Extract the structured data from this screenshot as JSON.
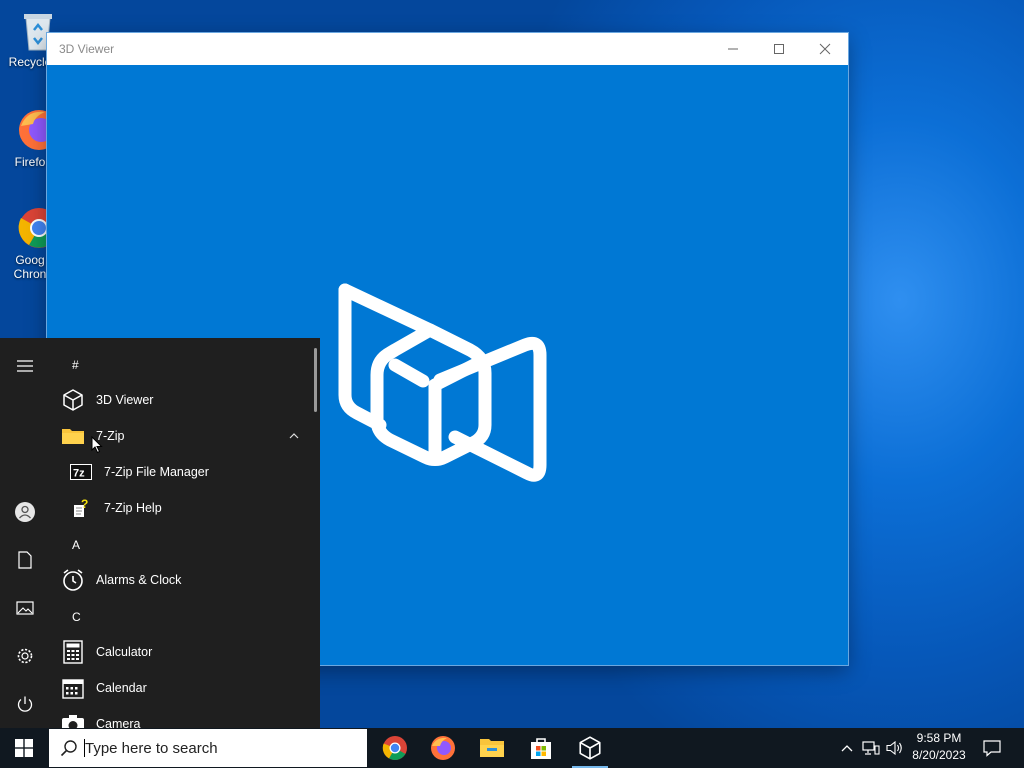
{
  "desktop": {
    "icons": [
      {
        "label": "Recycle",
        "icon": "recycle-bin-icon"
      },
      {
        "label": "Firefo",
        "icon": "firefox-icon"
      },
      {
        "label": "Goog\nChron",
        "icon": "chrome-icon"
      }
    ]
  },
  "window": {
    "title": "3D Viewer",
    "minimize_icon": "minimize-icon",
    "maximize_icon": "maximize-icon",
    "close_icon": "close-icon",
    "background": "#0078d4",
    "splash_icon": "3d-viewer-logo-icon"
  },
  "start_menu": {
    "rail": [
      "hamburger-icon",
      "user-icon",
      "document-icon",
      "pictures-icon",
      "settings-icon",
      "power-icon"
    ],
    "sections": [
      {
        "letter": "#"
      },
      {
        "app": "3D Viewer",
        "icon": "3d-cube-icon"
      },
      {
        "app": "7-Zip",
        "icon": "folder-icon",
        "expanded": true
      },
      {
        "app": "7-Zip File Manager",
        "icon": "7zip-icon",
        "sub": true
      },
      {
        "app": "7-Zip Help",
        "icon": "help-document-icon",
        "sub": true
      },
      {
        "letter": "A"
      },
      {
        "app": "Alarms & Clock",
        "icon": "alarm-clock-icon"
      },
      {
        "letter": "C"
      },
      {
        "app": "Calculator",
        "icon": "calculator-icon"
      },
      {
        "app": "Calendar",
        "icon": "calendar-icon"
      },
      {
        "app": "Camera",
        "icon": "camera-icon"
      }
    ]
  },
  "taskbar": {
    "search_placeholder": "Type here to search",
    "apps": [
      "chrome-icon",
      "firefox-icon",
      "file-explorer-icon",
      "store-icon",
      "3d-viewer-icon"
    ],
    "time": "9:58 PM",
    "date": "8/20/2023",
    "accent": "#76b9ed"
  }
}
